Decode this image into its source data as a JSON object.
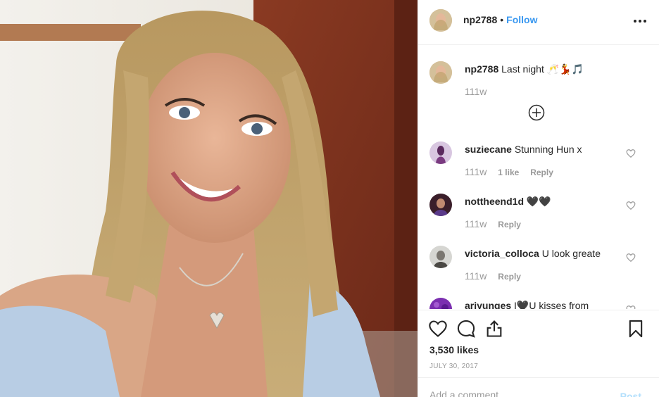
{
  "header": {
    "username": "np2788",
    "separator": "•",
    "follow_label": "Follow"
  },
  "caption": {
    "username": "np2788",
    "text": "Last night 🥂💃🎵",
    "time": "111w"
  },
  "comments": [
    {
      "username": "suziecane",
      "text": "Stunning Hun x",
      "time": "111w",
      "likes": "1 like",
      "reply": "Reply"
    },
    {
      "username": "nottheend1d",
      "text": "🖤🖤",
      "time": "111w",
      "likes": "",
      "reply": "Reply"
    },
    {
      "username": "victoria_colloca",
      "text": "U look greate",
      "time": "111w",
      "likes": "",
      "reply": "Reply"
    },
    {
      "username": "ariyunges",
      "text": "I🖤U kisses from",
      "time": "",
      "likes": "",
      "reply": ""
    }
  ],
  "stats": {
    "likes": "3,530 likes",
    "date": "JULY 30, 2017"
  },
  "composer": {
    "placeholder": "Add a comment…",
    "post_label": "Post"
  },
  "icons": {
    "more": "more-options-icon",
    "load_more": "plus-circle-icon",
    "like": "heart-icon",
    "comment": "comment-bubble-icon",
    "share": "share-icon",
    "save": "bookmark-icon"
  },
  "colors": {
    "link": "#3897f0",
    "muted": "#999999",
    "border": "#efefef",
    "post_disabled": "#b2dffc"
  }
}
